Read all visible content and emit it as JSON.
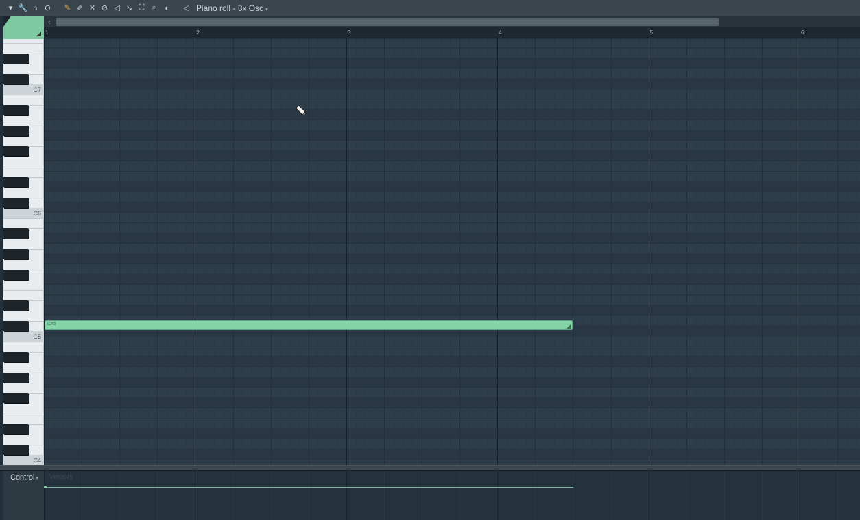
{
  "toolbar": {
    "icons": [
      "menu-arrow-icon",
      "wrench-icon",
      "magnet-icon",
      "stamp-icon",
      "pencil-icon",
      "paint-brush-icon",
      "delete-tool-icon",
      "mute-tool-icon",
      "mute-tool-2-icon",
      "slice-icon",
      "select-icon",
      "zoom-icon",
      "playback-icon"
    ],
    "title": "Piano roll - 3x Osc",
    "title_dropdown": "▾"
  },
  "ruler": {
    "bars": [
      "1",
      "2",
      "3",
      "4",
      "5",
      "6"
    ]
  },
  "keyboard": {
    "octaves": [
      "C7",
      "C6",
      "C5",
      "C4"
    ]
  },
  "note": {
    "label": "C#5",
    "pitch": "C#5",
    "start_bar": 1,
    "length_beats": 14
  },
  "control": {
    "label": "Control",
    "dropdown": "▾",
    "target": "Velocity"
  },
  "colors": {
    "note": "#84d3a6",
    "grid_bg": "#2d3e4a",
    "toolbar_bg": "#3a454d",
    "active_tool": "#e4a53a"
  }
}
